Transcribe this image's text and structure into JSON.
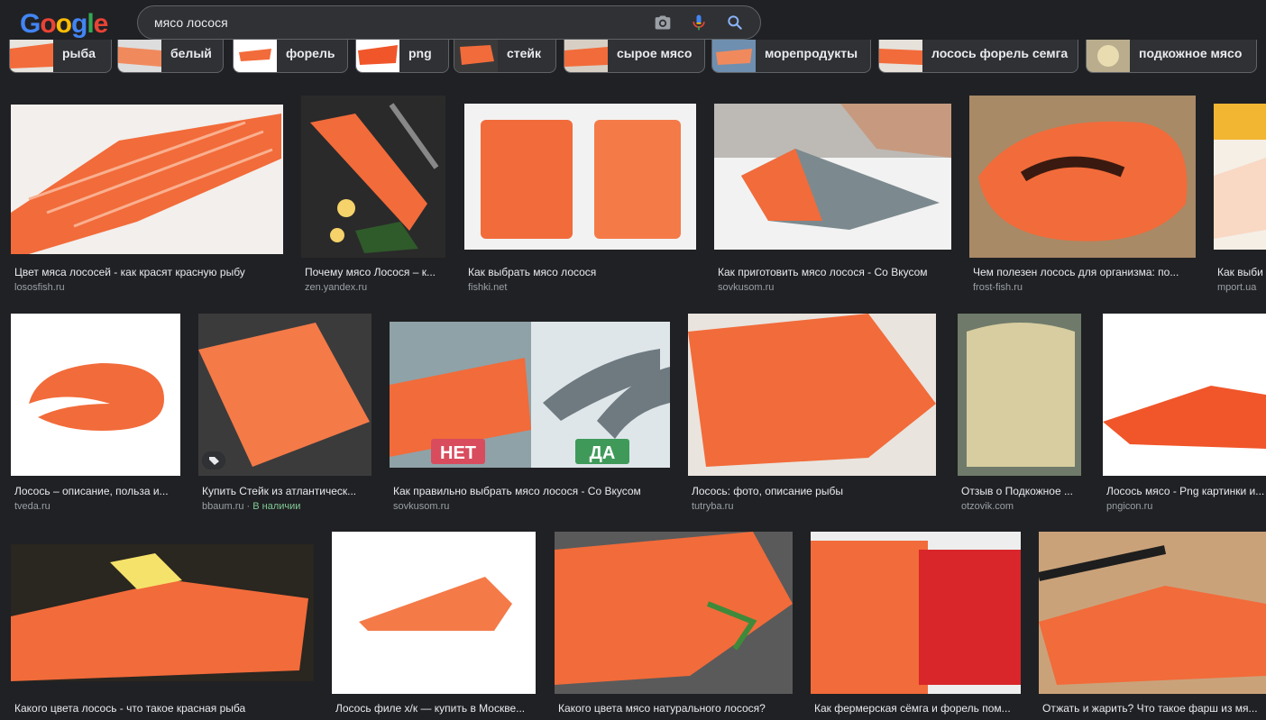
{
  "search": {
    "query": "мясо лосося"
  },
  "logo": {
    "letters": [
      "G",
      "o",
      "o",
      "g",
      "l",
      "e"
    ],
    "colors": [
      "#4285f4",
      "#ea4335",
      "#fbbc05",
      "#4285f4",
      "#34a853",
      "#ea4335"
    ]
  },
  "chips": [
    {
      "label": "рыба"
    },
    {
      "label": "белый"
    },
    {
      "label": "форель"
    },
    {
      "label": "png"
    },
    {
      "label": "стейк"
    },
    {
      "label": "сырое мясо"
    },
    {
      "label": "морепродукты"
    },
    {
      "label": "лосось форель семга"
    },
    {
      "label": "подкожное мясо"
    }
  ],
  "results": [
    {
      "title": "Цвет мяса лососей - как красят красную рыбу",
      "source": "lososfish.ru"
    },
    {
      "title": "Почему мясо Лосося – к...",
      "source": "zen.yandex.ru"
    },
    {
      "title": "Как выбрать мясо лосося",
      "source": "fishki.net"
    },
    {
      "title": "Как приготовить мясо лосося - Со Вкусом",
      "source": "sovkusom.ru"
    },
    {
      "title": "Чем полезен лосось для организма: по...",
      "source": "frost-fish.ru"
    },
    {
      "title": "Как выби",
      "source": "mport.ua"
    },
    {
      "title": "Лосось – описание, польза и...",
      "source": "tveda.ru"
    },
    {
      "title": "Купить Стейк из атлантическ...",
      "source": "bbaum.ru",
      "availability": "В наличии"
    },
    {
      "title": "Как правильно выбрать мясо лосося - Со Вкусом",
      "source": "sovkusom.ru",
      "badges": [
        "НЕТ",
        "ДА"
      ]
    },
    {
      "title": "Лосось: фото, описание рыбы",
      "source": "tutryba.ru"
    },
    {
      "title": "Отзыв о Подкожное ...",
      "source": "otzovik.com"
    },
    {
      "title": "Лосось мясо - Png картинки и...",
      "source": "pngicon.ru"
    },
    {
      "title": "Какого цвета лосось - что такое красная рыба",
      "source": ""
    },
    {
      "title": "Лосось филе х/к — купить в Москве...",
      "source": ""
    },
    {
      "title": "Какого цвета мясо натурального лосося?",
      "source": ""
    },
    {
      "title": "Как фермерская сёмга и форель пом...",
      "source": ""
    },
    {
      "title": "Отжать и жарить? Что такое фарш из мя...",
      "source": ""
    }
  ],
  "colors": {
    "salmon": "#f26b3a",
    "salmon_light": "#f9a07a",
    "background": "#202124",
    "chip_bg": "#303134",
    "available": "#81c995",
    "badge_no": "#d94c5e",
    "badge_yes": "#3f9a5a"
  }
}
